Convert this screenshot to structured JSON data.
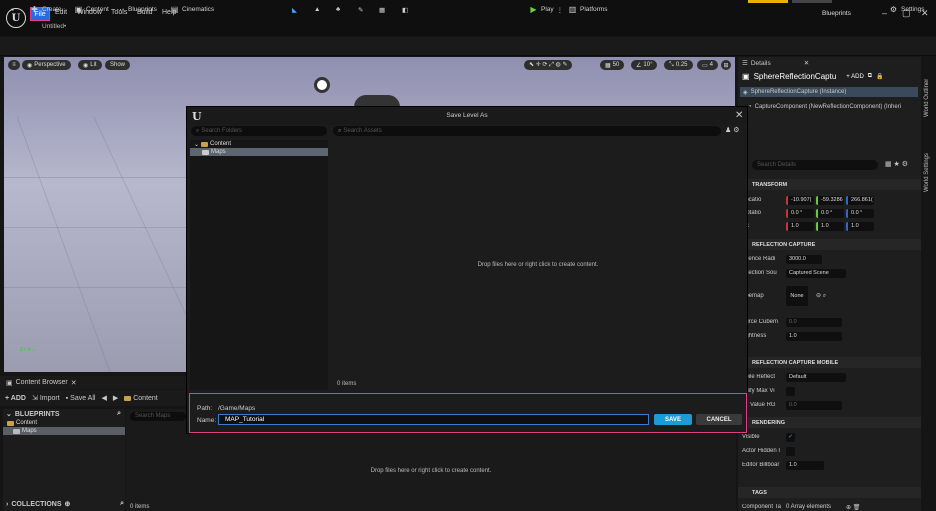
{
  "titlebar": {
    "menu": [
      "File",
      "Edit",
      "Window",
      "Tools",
      "Build",
      "Help"
    ],
    "doc_tab": "Untitled•",
    "project": "Blueprints"
  },
  "toolbar": {
    "create": "Create",
    "content": "Content",
    "blueprints": "Blueprints",
    "cinematics": "Cinematics",
    "play": "Play",
    "platforms": "Platforms",
    "settings": "Settings"
  },
  "viewport": {
    "perspective": "Perspective",
    "lit": "Lit",
    "show": "Show",
    "grid_size": "50",
    "angle": "10°",
    "scale": "0.25",
    "camera_speed": "4"
  },
  "modal": {
    "title": "Save Level As",
    "folders_search_placeholder": "Search Folders",
    "assets_search_placeholder": "Search Assets",
    "tree": [
      "Content",
      "Maps"
    ],
    "drop_hint": "Drop files here or right click to create content.",
    "items_count": "0 items",
    "path_label": "Path:",
    "path_value": "/Game/Maps",
    "name_label": "Name:",
    "name_value": "MAP_Tutorial",
    "save": "SAVE",
    "cancel": "CANCEL"
  },
  "details": {
    "tab": "Details",
    "actor": "SphereReflectionCaptu",
    "add": "+ ADD",
    "instance": "SphereReflectionCapture (Instance)",
    "component": "CaptureComponent (NewReflectionComponent) (Inheri",
    "search_placeholder": "Search Details",
    "transform": "TRANSFORM",
    "location_label": "Locatio",
    "location": [
      "-10.907(",
      "-59.3286",
      "266.861("
    ],
    "rotation_label": "Rotatio",
    "rotation": [
      "0.0 °",
      "0.0 °",
      "0.0 °"
    ],
    "scale_label": "Sc",
    "scale": [
      "1.0",
      "1.0",
      "1.0"
    ],
    "reflection_capture": "REFLECTION CAPTURE",
    "influence_label": "fluence Radi",
    "influence_value": "3000.0",
    "source_label": "eflection Sou",
    "source_value": "Captured Scene",
    "cubemap_label": "ubemap",
    "cubemap_value": "None",
    "source_cubemap_label": "ource Cubem",
    "source_cubemap_value": "0.0",
    "brightness_label": "rightness",
    "brightness_value": "1.0",
    "mobile": "REFLECTION CAPTURE MOBILE",
    "mobile_reflect_label": "obile Reflect",
    "mobile_reflect_value": "Default",
    "modify_label": "odify Max Vi",
    "max_value_label": "ax Value RG",
    "max_value": "0.0",
    "rendering": "RENDERING",
    "visible_label": "Visible",
    "actor_hidden_label": "Actor Hidden I",
    "editor_billboard_label": "Editor Billboar",
    "editor_billboard_value": "1.0",
    "tags": "TAGS",
    "component_tags_label": "Component Ta",
    "component_tags_value": "0 Array elements",
    "side_outliner": "World Outliner",
    "side_settings": "World Settings"
  },
  "content_browser": {
    "tab": "Content Browser",
    "add": "+ ADD",
    "import": "Import",
    "save_all": "Save All",
    "path_root": "Content",
    "blueprints_section": "BLUEPRINTS",
    "tree": [
      "Content",
      "Maps"
    ],
    "search_placeholder": "Search Maps",
    "drop_hint": "Drop files here or right click to create content.",
    "collections": "COLLECTIONS",
    "items_count": "0 items"
  },
  "colors": {
    "accent_blue": "#1b9bd8",
    "highlight_pink": "#e23c8a",
    "folder_gold": "#c9a14a"
  }
}
